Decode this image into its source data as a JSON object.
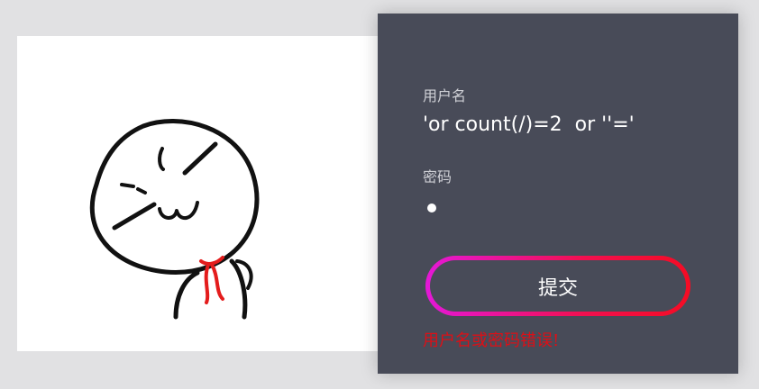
{
  "login": {
    "username_label": "用户名",
    "username_value": "'or count(/)=2  or ''='",
    "password_label": "密码",
    "submit_label": "提交",
    "error_message": "用户名或密码错误!"
  },
  "colors": {
    "panel_bg": "#484b58",
    "button_gradient_start": "#e418d7",
    "button_gradient_end": "#f50c24",
    "error": "#dd0f16"
  },
  "illustration": {
    "icon": "smug-stick-figure-icon"
  }
}
